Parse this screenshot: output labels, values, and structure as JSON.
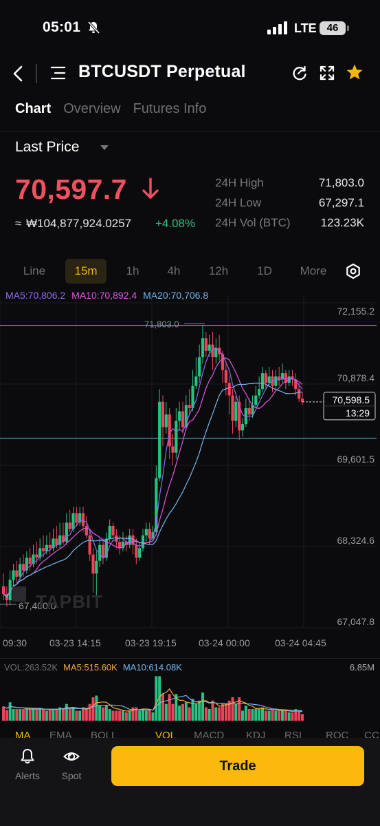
{
  "status_bar": {
    "time": "05:01",
    "network": "LTE",
    "battery": "46"
  },
  "nav": {
    "title": "BTCUSDT Perpetual",
    "icons": [
      "back-icon",
      "menu-icon",
      "refresh-icon",
      "expand-icon",
      "star-icon"
    ],
    "star_color": "#f6b70a"
  },
  "tabs": [
    {
      "label": "Chart",
      "active": true
    },
    {
      "label": "Overview",
      "active": false
    },
    {
      "label": "Futures Info",
      "active": false
    }
  ],
  "price": {
    "type_label": "Last Price",
    "last": "70,597.7",
    "direction": "down",
    "approx_prefix": "≈",
    "converted": "₩104,877,924.0257",
    "change": "+4.08%",
    "down_color": "#f0515e",
    "up_color": "#2ec27e"
  },
  "stats": [
    {
      "label": "24H High",
      "value": "71,803.0"
    },
    {
      "label": "24H Low",
      "value": "67,297.1"
    },
    {
      "label": "24H Vol (BTC)",
      "value": "123.23K"
    }
  ],
  "timeframes": [
    {
      "label": "Line",
      "active": false
    },
    {
      "label": "15m",
      "active": true
    },
    {
      "label": "1h",
      "active": false
    },
    {
      "label": "4h",
      "active": false
    },
    {
      "label": "12h",
      "active": false
    },
    {
      "label": "1D",
      "active": false
    },
    {
      "label": "More",
      "active": false
    }
  ],
  "ma_legend": [
    {
      "label": "MA5:70,806.2",
      "color": "#8f6cf0"
    },
    {
      "label": "MA10:70,892.4",
      "color": "#e655e6"
    },
    {
      "label": "MA20:70,706.8",
      "color": "#73b8ef"
    }
  ],
  "chart_data": {
    "type": "candlestick",
    "interval": "15m",
    "y_ticks": [
      "72,155.2",
      "70,878.4",
      "69,601.5",
      "68,324.6",
      "67,047.8"
    ],
    "x_ticks": [
      "09:30",
      "03-23 14:15",
      "03-23 19:15",
      "03-24 00:00",
      "03-24 04:45"
    ],
    "ylim": [
      67047.8,
      72155.2
    ],
    "high_marker": "71,803.0",
    "low_marker": "67,400.0",
    "current_price_label": "70,598.5",
    "countdown": "13:29",
    "horizontal_lines": [
      71803.0,
      70028.0
    ],
    "watermark": "TAPBIT",
    "up_color": "#26c281",
    "down_color": "#f0435a",
    "ma_colors": {
      "ma5": "#8f6cf0",
      "ma10": "#e655e6",
      "ma20": "#73b8ef"
    },
    "candles": [
      [
        67700,
        67580,
        67900,
        67480
      ],
      [
        67580,
        67480,
        67700,
        67380
      ],
      [
        67480,
        67800,
        67950,
        67400
      ],
      [
        67800,
        67950,
        68050,
        67700
      ],
      [
        67950,
        67850,
        68100,
        67750
      ],
      [
        67850,
        68050,
        68150,
        67800
      ],
      [
        68050,
        67950,
        68200,
        67850
      ],
      [
        67950,
        68150,
        68250,
        67900
      ],
      [
        68150,
        68050,
        68300,
        67950
      ],
      [
        68050,
        68200,
        68350,
        68000
      ],
      [
        68200,
        68150,
        68400,
        68050
      ],
      [
        68150,
        68300,
        68450,
        68100
      ],
      [
        68300,
        68250,
        68500,
        68150
      ],
      [
        68250,
        68350,
        68500,
        68200
      ],
      [
        68350,
        68300,
        68550,
        68200
      ],
      [
        68300,
        68450,
        68600,
        68250
      ],
      [
        68450,
        68350,
        68650,
        68300
      ],
      [
        68350,
        68500,
        68700,
        68300
      ],
      [
        68500,
        68400,
        68700,
        68350
      ],
      [
        68400,
        68700,
        68850,
        68350
      ],
      [
        68700,
        68600,
        68900,
        68550
      ],
      [
        68600,
        68850,
        68950,
        68550
      ],
      [
        68850,
        68700,
        68950,
        68650
      ],
      [
        68700,
        68850,
        68950,
        68650
      ],
      [
        68850,
        68650,
        68950,
        68550
      ],
      [
        68650,
        68500,
        68800,
        68450
      ],
      [
        68500,
        68200,
        68600,
        68100
      ],
      [
        68200,
        67900,
        68300,
        67600
      ],
      [
        67900,
        68100,
        68250,
        67500
      ],
      [
        68100,
        68350,
        68450,
        68000
      ],
      [
        68350,
        68150,
        68450,
        68050
      ],
      [
        68150,
        68450,
        68550,
        68100
      ],
      [
        68450,
        68650,
        68750,
        68400
      ],
      [
        68650,
        68500,
        68700,
        68400
      ],
      [
        68500,
        68400,
        68600,
        68300
      ],
      [
        68400,
        68300,
        68500,
        68200
      ],
      [
        68300,
        68400,
        68550,
        68250
      ],
      [
        68400,
        68350,
        68500,
        68250
      ],
      [
        68350,
        68500,
        68600,
        68300
      ],
      [
        68500,
        68350,
        68600,
        68200
      ],
      [
        68350,
        68150,
        68450,
        68050
      ],
      [
        68150,
        68300,
        68400,
        68100
      ],
      [
        68300,
        68500,
        68600,
        68250
      ],
      [
        68500,
        68600,
        68700,
        68400
      ],
      [
        68600,
        68450,
        68700,
        68350
      ],
      [
        68450,
        68550,
        68650,
        68400
      ],
      [
        68550,
        69400,
        69600,
        68500
      ],
      [
        69400,
        70600,
        70800,
        69350
      ],
      [
        70600,
        70200,
        70700,
        69900
      ],
      [
        70200,
        70400,
        70600,
        70100
      ],
      [
        70400,
        69900,
        70500,
        69700
      ],
      [
        69900,
        69800,
        70100,
        69600
      ],
      [
        69800,
        70300,
        70500,
        69700
      ],
      [
        70300,
        70450,
        70600,
        70150
      ],
      [
        70450,
        70200,
        70600,
        70100
      ],
      [
        70200,
        70550,
        70700,
        70150
      ],
      [
        70550,
        70500,
        70800,
        70400
      ],
      [
        70500,
        70850,
        71100,
        70450
      ],
      [
        70850,
        71000,
        71300,
        70800
      ],
      [
        71000,
        71300,
        71500,
        70900
      ],
      [
        71300,
        71600,
        71803,
        71200
      ],
      [
        71600,
        71400,
        71700,
        71300
      ],
      [
        71400,
        71500,
        71650,
        71300
      ],
      [
        71500,
        71300,
        71700,
        71100
      ],
      [
        71300,
        71450,
        71600,
        71200
      ],
      [
        71450,
        71350,
        71650,
        71250
      ],
      [
        71350,
        71100,
        71400,
        70900
      ],
      [
        71100,
        70900,
        71200,
        70700
      ],
      [
        70900,
        70700,
        71000,
        70400
      ],
      [
        70700,
        70300,
        70800,
        70100
      ],
      [
        70300,
        70600,
        70700,
        70200
      ],
      [
        70600,
        70150,
        70700,
        70000
      ],
      [
        70150,
        70250,
        70350,
        70050
      ],
      [
        70250,
        70500,
        70650,
        70200
      ],
      [
        70500,
        70400,
        70650,
        70300
      ],
      [
        70400,
        70550,
        70700,
        70350
      ],
      [
        70550,
        70700,
        70850,
        70500
      ],
      [
        70700,
        70800,
        71000,
        70650
      ],
      [
        70800,
        71050,
        71150,
        70750
      ],
      [
        71050,
        70900,
        71100,
        70800
      ],
      [
        70900,
        71000,
        71150,
        70850
      ],
      [
        71000,
        70850,
        71100,
        70750
      ],
      [
        70850,
        71000,
        71100,
        70800
      ],
      [
        71000,
        70950,
        71150,
        70850
      ],
      [
        70950,
        71050,
        71200,
        70900
      ],
      [
        71050,
        70900,
        71100,
        70800
      ],
      [
        70900,
        71000,
        71100,
        70850
      ],
      [
        71000,
        70950,
        71100,
        70850
      ],
      [
        70950,
        70800,
        71050,
        70700
      ],
      [
        70800,
        70650,
        70900,
        70600
      ],
      [
        70650,
        70597.7,
        70750,
        70550
      ]
    ]
  },
  "volume": {
    "vol_label": "VOL:263.52K",
    "ma5_label": "MA5:515.60K",
    "ma10_label": "MA10:614.08K",
    "axis_max": "6.85M",
    "ma5_color": "#f2a93b",
    "ma10_color": "#73b8ef"
  },
  "indicators": [
    {
      "label": "MA",
      "active": true
    },
    {
      "label": "EMA",
      "active": false
    },
    {
      "label": "BOLL",
      "active": false
    },
    {
      "label": "VOL",
      "active": true
    },
    {
      "label": "MACD",
      "active": false
    },
    {
      "label": "KDJ",
      "active": false
    },
    {
      "label": "RSI",
      "active": false
    },
    {
      "label": "ROC",
      "active": false
    },
    {
      "label": "CCI",
      "active": false
    }
  ],
  "bottom": {
    "alerts_label": "Alerts",
    "spot_label": "Spot",
    "trade_label": "Trade"
  }
}
